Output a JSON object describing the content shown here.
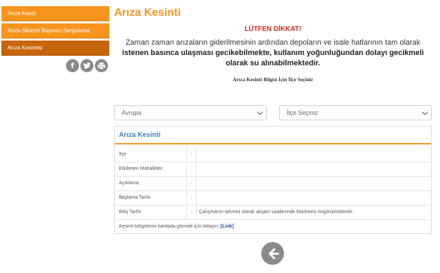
{
  "sidebar": {
    "items": [
      {
        "label": "Arıza Kaydı"
      },
      {
        "label": "Arıza Şikayet Başvuru Sorgulama"
      },
      {
        "label": "Arıza Kesintisi"
      }
    ]
  },
  "share": {
    "facebook": "f"
  },
  "page": {
    "title": "Arıza Kesinti",
    "attention": "LÜTFEN DİKKAT!",
    "notice_plain": "Zaman zaman arızaların giderilmesinin ardından depoların ve isale hatlarının tam olarak ",
    "notice_bold": "istenen basınca ulaşması gecikebilmekte, kullanım yoğunluğundan dolayı gecikmeli olarak su alınabilmektedir.",
    "instruction": "Arıza Kesinti Bilgisi İçin İlçe Seçiniz"
  },
  "selects": {
    "region": "Avrupa",
    "district": "İlçe Seçiniz"
  },
  "panel": {
    "title": "Arıza Kesinti",
    "rows": [
      {
        "label": "İlçe",
        "sep": ":",
        "value": ""
      },
      {
        "label": "Etkilenen Mahalleler",
        "sep": ":",
        "value": ""
      },
      {
        "label": "Açıklama",
        "sep": ":",
        "value": ""
      },
      {
        "label": "Başlama Tarihi",
        "sep": ":",
        "value": ""
      },
      {
        "label": "Bitiş Tarihi",
        "sep": ":",
        "value": "Çalışmanın tahmini olarak akşam saatlerinde bitirilmesi öngörülmektedir."
      }
    ],
    "map_text": "Kesinti bölgelerini haritada görmek için tıklayın: ",
    "map_link": "[Link]"
  },
  "colors": {
    "accent": "#f7941d",
    "active": "#c8650a",
    "alert": "#d9261c",
    "panel_title": "#3a7fc1"
  }
}
